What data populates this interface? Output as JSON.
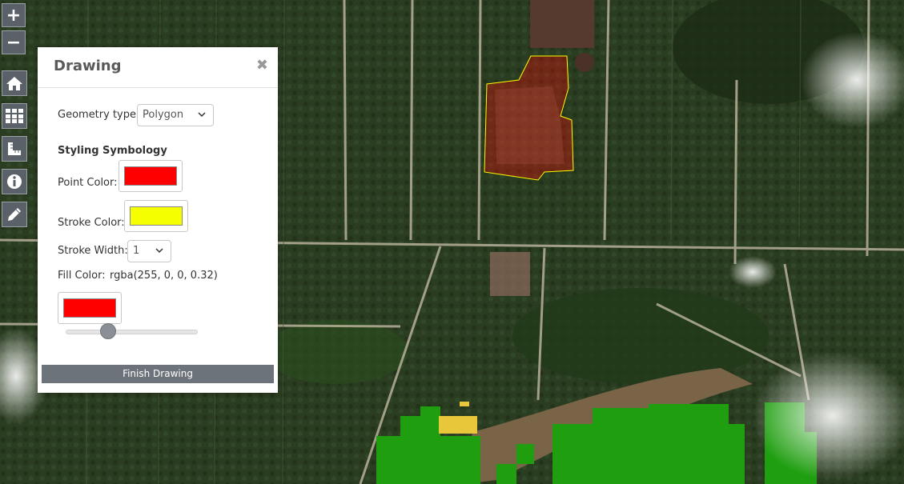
{
  "map": {
    "colors": {
      "plantation": "#28391f",
      "road": "#b8b09a",
      "river": "#7a6448",
      "veg_green": "#1f9e10",
      "veg_yellow": "#e8c83a",
      "drawn_fill": "rgba(255,0,0,0.32)",
      "drawn_stroke": "#ffff00"
    }
  },
  "toolbar": {
    "zoom_in_label": "+",
    "zoom_out_label": "−",
    "tools": [
      "home-icon",
      "grid-icon",
      "measure-icon",
      "info-icon",
      "pencil-icon"
    ]
  },
  "panel": {
    "title": "Drawing",
    "close_label": "✖",
    "geometry_label": "Geometry type:",
    "geometry_value": "Polygon",
    "styling_heading": "Styling Symbology",
    "point_color_label": "Point Color:",
    "point_color": "#ff0000",
    "stroke_color_label": "Stroke Color:",
    "stroke_color": "#f5ff00",
    "stroke_width_label": "Stroke Width:",
    "stroke_width_value": "1",
    "fill_color_label": "Fill Color:",
    "fill_color_value": "rgba(255, 0, 0, 0.32)",
    "fill_color": "#ff0000",
    "opacity_fraction": 0.32,
    "finish_label": "Finish Drawing"
  }
}
